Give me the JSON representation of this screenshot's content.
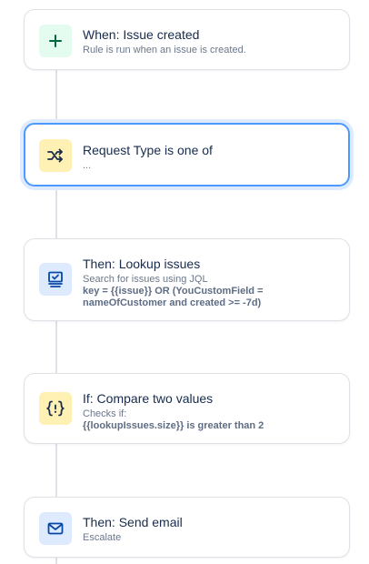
{
  "steps": [
    {
      "title": "When: Issue created",
      "subtitle": "Rule is run when an issue is created.",
      "icon": "plus-icon"
    },
    {
      "title": "Request Type is one of",
      "subtitle": "...",
      "icon": "shuffle-icon"
    },
    {
      "title": "Then: Lookup issues",
      "subtitle": "Search for issues using JQL",
      "detail": "key = {{issue}} OR (YouCustomField = nameOfCustomer and created >= -7d)",
      "icon": "lookup-icon"
    },
    {
      "title": "If: Compare two values",
      "subtitle": "Checks if:",
      "detail": "{{lookupIssues.size}} is greater than 2",
      "icon": "curly-braces-icon"
    },
    {
      "title": "Then: Send email",
      "subtitle": "Escalate",
      "icon": "envelope-icon"
    }
  ],
  "colors": {
    "selected_border": "#4c9aff",
    "trigger_icon_bg": "#e3fcef",
    "condition_icon_bg": "#fff0b3",
    "action_icon_bg": "#deebff"
  }
}
